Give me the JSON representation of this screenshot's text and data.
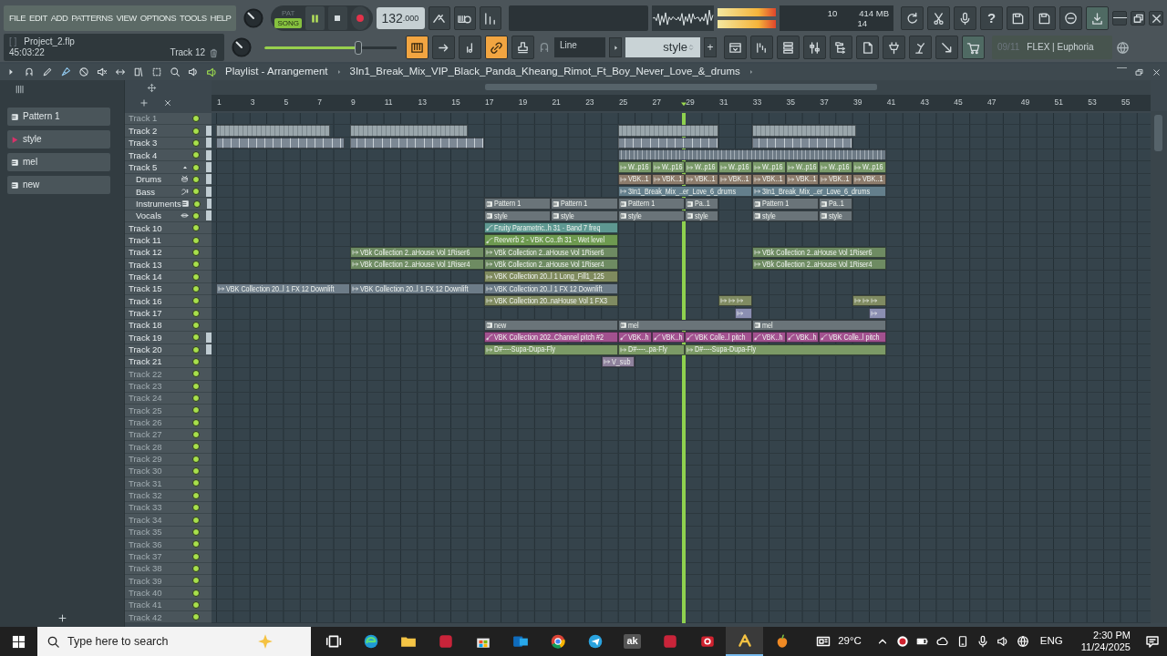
{
  "menu": [
    "FILE",
    "EDIT",
    "ADD",
    "PATTERNS",
    "VIEW",
    "OPTIONS",
    "TOOLS",
    "HELP"
  ],
  "transport": {
    "modes": [
      {
        "label": "PAT",
        "selected": false
      },
      {
        "label": "SONG",
        "selected": true
      }
    ],
    "playing": true
  },
  "tempo": "132",
  "tempo_fraction": ".000",
  "output_meter": [
    {
      "level": 1.0
    },
    {
      "level": 1.0
    }
  ],
  "cpu_panel": {
    "cpu": "10",
    "memory": "414 MB",
    "polyphony": "14"
  },
  "help_label": "?",
  "hint_panel": {
    "bracket": "[ ]",
    "project": "Project_2.flp",
    "time": "45:03:22",
    "track": "Track 12"
  },
  "master_volume": {
    "level": 0.71
  },
  "tool_buttons": [
    {
      "on": true
    },
    {
      "on": false
    },
    {
      "on": false
    },
    {
      "on": true
    },
    {
      "on": false
    }
  ],
  "snap": "Line",
  "pattern_selector": "style",
  "add_label": "+",
  "news": {
    "date": "09/11",
    "title": "FLEX | Euphoria"
  },
  "playlist": {
    "title": "Playlist - Arrangement",
    "arrangement": "3In1_Break_Mix_VIP_Black_Panda_Kheang_Rimot_Ft_Boy_Never_Love_&_drums"
  },
  "picker": [
    {
      "label": "Pattern 1",
      "selected": false
    },
    {
      "label": "style",
      "selected": true
    },
    {
      "label": "mel",
      "selected": false
    },
    {
      "label": "new",
      "selected": false
    }
  ],
  "ruler": [
    "1",
    "3",
    "5",
    "7",
    "9",
    "11",
    "13",
    "15",
    "17",
    "19",
    "21",
    "23",
    "25",
    "27",
    "29",
    "31",
    "33",
    "35",
    "37",
    "39",
    "41",
    "43",
    "45",
    "47",
    "49",
    "51",
    "53",
    "55"
  ],
  "tracks": [
    {
      "name": "Track 1",
      "dimmed": true,
      "on": true,
      "marked": false
    },
    {
      "name": "Track 2",
      "dimmed": false,
      "on": true,
      "marked": true,
      "clips": [
        {
          "kind": "blank",
          "color": "#9aa6ab"
        },
        {
          "kind": "blank",
          "color": "#9aa6ab"
        },
        {
          "kind": "blank",
          "color": "#9aa6ab"
        },
        {
          "kind": "blank",
          "color": "#9aa6ab"
        }
      ]
    },
    {
      "name": "Track 3",
      "dimmed": false,
      "on": true,
      "marked": true,
      "clips": [
        {
          "kind": "slices",
          "color": "#7c8894"
        },
        {
          "kind": "slices",
          "color": "#7c8894"
        },
        {
          "kind": "slices",
          "color": "#7c8894"
        },
        {
          "kind": "slices",
          "color": "#7c8894"
        }
      ]
    },
    {
      "name": "Track 4",
      "dimmed": false,
      "on": true,
      "marked": true,
      "clips": [
        {
          "kind": "stripe",
          "color": "#6d7a85"
        }
      ]
    },
    {
      "name": "Track 5",
      "dimmed": false,
      "on": true,
      "marked": true,
      "expanded": true,
      "clips": [
        {
          "kind": "audio",
          "label": "W..p16",
          "color": "#7a9a6a"
        },
        {
          "kind": "audio",
          "label": "W..p16",
          "color": "#7a9a6a"
        },
        {
          "kind": "audio",
          "label": "W..p16",
          "color": "#7a9a6a"
        },
        {
          "kind": "audio",
          "label": "W..p16",
          "color": "#7a9a6a"
        },
        {
          "kind": "audio",
          "label": "W..p16",
          "color": "#7a9a6a"
        },
        {
          "kind": "audio",
          "label": "W..p16",
          "color": "#7a9a6a"
        },
        {
          "kind": "audio",
          "label": "W..p16",
          "color": "#7a9a6a"
        },
        {
          "kind": "audio",
          "label": "W..p16",
          "color": "#7a9a6a"
        }
      ],
      "children": [
        {
          "name": "Drums",
          "dimmed": false,
          "on": true,
          "marked": true,
          "clips": [
            {
              "kind": "audio",
              "label": "VBK..1",
              "color": "#8d7c6c"
            },
            {
              "kind": "audio",
              "label": "VBK..1",
              "color": "#8d7c6c"
            },
            {
              "kind": "audio",
              "label": "VBK..1",
              "color": "#8d7c6c"
            },
            {
              "kind": "audio",
              "label": "VBK..1",
              "color": "#8d7c6c"
            },
            {
              "kind": "audio",
              "label": "VBK..1",
              "color": "#8d7c6c"
            },
            {
              "kind": "audio",
              "label": "VBK..1",
              "color": "#8d7c6c"
            },
            {
              "kind": "audio",
              "label": "VBK..1",
              "color": "#8d7c6c"
            },
            {
              "kind": "audio",
              "label": "VBK..1",
              "color": "#8d7c6c"
            }
          ]
        },
        {
          "name": "Bass",
          "dimmed": false,
          "on": true,
          "marked": true,
          "clips": [
            {
              "kind": "audio",
              "label": "3In1_Break_Mix_..er_Love_6_drums",
              "color": "#647f8c"
            },
            {
              "kind": "audio",
              "label": "3In1_Break_Mix_..er_Love_6_drums",
              "color": "#647f8c"
            }
          ]
        },
        {
          "name": "Instruments",
          "dimmed": false,
          "on": true,
          "marked": true,
          "clips": [
            {
              "kind": "pattern",
              "label": "Pattern 1",
              "color": "#6a7479"
            },
            {
              "kind": "pattern",
              "label": "Pattern 1",
              "color": "#6a7479"
            },
            {
              "kind": "pattern",
              "label": "Pattern 1",
              "color": "#6a7479"
            },
            {
              "kind": "pattern",
              "label": "Pa..1",
              "color": "#6a7479"
            },
            {
              "kind": "pattern",
              "label": "Pattern 1",
              "color": "#6a7479"
            },
            {
              "kind": "pattern",
              "label": "Pa..1",
              "color": "#6a7479"
            }
          ]
        },
        {
          "name": "Vocals",
          "dimmed": false,
          "on": true,
          "marked": true,
          "clips": [
            {
              "kind": "pattern",
              "label": "style",
              "color": "#6a7479"
            },
            {
              "kind": "pattern",
              "label": "style",
              "color": "#6a7479"
            },
            {
              "kind": "pattern",
              "label": "style",
              "color": "#6a7479"
            },
            {
              "kind": "pattern",
              "label": "style",
              "color": "#6a7479"
            },
            {
              "kind": "pattern",
              "label": "style",
              "color": "#6a7479"
            },
            {
              "kind": "pattern",
              "label": "style",
              "color": "#6a7479"
            }
          ]
        }
      ]
    },
    {
      "name": "Track 10",
      "dimmed": false,
      "on": true,
      "marked": false,
      "clips": [
        {
          "kind": "automation",
          "label": "Fruity Parametric..h 31 - Band 7 freq",
          "color": "#5e9891"
        }
      ]
    },
    {
      "name": "Track 11",
      "dimmed": false,
      "on": true,
      "marked": false,
      "clips": [
        {
          "kind": "automation",
          "label": "Reeverb 2 - VBK Co..th 31 - Wet level",
          "color": "#6e9a50"
        }
      ]
    },
    {
      "name": "Track 12",
      "dimmed": false,
      "on": true,
      "marked": false,
      "clips": [
        {
          "kind": "audio",
          "label": "VBk Collection 2..aHouse Vol 1Riser6",
          "color": "#6e8b62"
        },
        {
          "kind": "audio",
          "label": "VBk Collection 2..aHouse Vol 1Riser6",
          "color": "#6e8b62"
        },
        {
          "kind": "audio",
          "label": "VBk Collection 2..aHouse Vol 1Riser6",
          "color": "#6e8b62"
        }
      ]
    },
    {
      "name": "Track 13",
      "dimmed": false,
      "on": true,
      "marked": false,
      "clips": [
        {
          "kind": "audio",
          "label": "VBk Collection 2..aHouse Vol 1Riser4",
          "color": "#6e8b62"
        },
        {
          "kind": "audio",
          "label": "VBk Collection 2..aHouse Vol 1Riser4",
          "color": "#6e8b62"
        },
        {
          "kind": "audio",
          "label": "VBk Collection 2..aHouse Vol 1Riser4",
          "color": "#6e8b62"
        }
      ]
    },
    {
      "name": "Track 14",
      "dimmed": false,
      "on": true,
      "marked": false,
      "clips": [
        {
          "kind": "audio",
          "label": "VBK Collection 20..l 1 Long_Fill1_125",
          "color": "#7f8a5e"
        }
      ]
    },
    {
      "name": "Track 15",
      "dimmed": false,
      "on": true,
      "marked": false,
      "clips": [
        {
          "kind": "audio",
          "label": "VBK Collection 20..l 1 FX 12 Downlift",
          "color": "#6d7c88"
        },
        {
          "kind": "audio",
          "label": "VBK Collection 20..l 1 FX 12 Downlift",
          "color": "#6d7c88"
        },
        {
          "kind": "audio",
          "label": "VBK Collection 20..l 1 FX 12 Downlift",
          "color": "#6d7c88"
        }
      ]
    },
    {
      "name": "Track 16",
      "dimmed": false,
      "on": true,
      "marked": false,
      "clips": [
        {
          "kind": "audio",
          "label": "VBK Collection 20..naHouse Vol 1 FX3",
          "color": "#808b62"
        },
        {
          "kind": "chops",
          "color": "#808b62"
        },
        {
          "kind": "chops",
          "color": "#808b62"
        }
      ]
    },
    {
      "name": "Track 17",
      "dimmed": false,
      "on": true,
      "marked": false,
      "clips": [
        {
          "kind": "audio",
          "color": "#8b8fb2"
        },
        {
          "kind": "audio",
          "color": "#8b8fb2"
        }
      ]
    },
    {
      "name": "Track 18",
      "dimmed": false,
      "on": true,
      "marked": false,
      "clips": [
        {
          "kind": "pattern",
          "label": "new",
          "color": "#6a7479"
        },
        {
          "kind": "pattern",
          "label": "mel",
          "color": "#6a7479"
        },
        {
          "kind": "pattern",
          "label": "mel",
          "color": "#6a7479"
        }
      ]
    },
    {
      "name": "Track 19",
      "dimmed": false,
      "on": true,
      "marked": true,
      "clips": [
        {
          "kind": "automation",
          "label": "VBK Collection 202..Channel pitch #2",
          "color": "#a2518f"
        },
        {
          "kind": "automation",
          "label": "VBK..h",
          "color": "#a2518f"
        },
        {
          "kind": "automation",
          "label": "VBK..h",
          "color": "#a2518f"
        },
        {
          "kind": "automation",
          "label": "VBK Colle..l pitch",
          "color": "#a2518f"
        },
        {
          "kind": "automation",
          "label": "VBK..h",
          "color": "#a2518f"
        },
        {
          "kind": "automation",
          "label": "VBK..h",
          "color": "#a2518f"
        },
        {
          "kind": "automation",
          "label": "VBK Colle..l pitch",
          "color": "#a2518f"
        }
      ]
    },
    {
      "name": "Track 20",
      "dimmed": false,
      "on": true,
      "marked": true,
      "clips": [
        {
          "kind": "audio",
          "label": "D#----Supa-Dupa-Fly",
          "color": "#7c9a66"
        },
        {
          "kind": "audio",
          "label": "D#----..pa-Fly",
          "color": "#7c9a66"
        },
        {
          "kind": "audio",
          "label": "D#----Supa-Dupa-Fly",
          "color": "#7c9a66"
        }
      ]
    },
    {
      "name": "Track 21",
      "dimmed": false,
      "on": true,
      "marked": false,
      "clips": [
        {
          "kind": "audio",
          "label": "V_sub",
          "color": "#8e819c"
        }
      ]
    },
    {
      "name": "Track 22",
      "dimmed": true,
      "on": true,
      "marked": false
    },
    {
      "name": "Track 23",
      "dimmed": true,
      "on": true,
      "marked": false
    },
    {
      "name": "Track 24",
      "dimmed": true,
      "on": true,
      "marked": false
    },
    {
      "name": "Track 25",
      "dimmed": true,
      "on": true,
      "marked": false
    },
    {
      "name": "Track 26",
      "dimmed": true,
      "on": true,
      "marked": false
    },
    {
      "name": "Track 27",
      "dimmed": true,
      "on": true,
      "marked": false
    },
    {
      "name": "Track 28",
      "dimmed": true,
      "on": true,
      "marked": false
    },
    {
      "name": "Track 29",
      "dimmed": true,
      "on": true,
      "marked": false
    },
    {
      "name": "Track 30",
      "dimmed": true,
      "on": true,
      "marked": false
    },
    {
      "name": "Track 31",
      "dimmed": true,
      "on": true,
      "marked": false
    },
    {
      "name": "Track 32",
      "dimmed": true,
      "on": true,
      "marked": false
    },
    {
      "name": "Track 33",
      "dimmed": true,
      "on": true,
      "marked": false
    },
    {
      "name": "Track 34",
      "dimmed": true,
      "on": true,
      "marked": false
    },
    {
      "name": "Track 35",
      "dimmed": true,
      "on": true,
      "marked": false
    },
    {
      "name": "Track 36",
      "dimmed": true,
      "on": true,
      "marked": false
    },
    {
      "name": "Track 37",
      "dimmed": true,
      "on": true,
      "marked": false
    },
    {
      "name": "Track 38",
      "dimmed": true,
      "on": true,
      "marked": false
    },
    {
      "name": "Track 39",
      "dimmed": true,
      "on": true,
      "marked": false
    },
    {
      "name": "Track 40",
      "dimmed": true,
      "on": true,
      "marked": false
    },
    {
      "name": "Track 41",
      "dimmed": true,
      "on": true,
      "marked": false
    },
    {
      "name": "Track 42",
      "dimmed": true,
      "on": true,
      "marked": false
    }
  ],
  "taskbar": {
    "search_placeholder": "Type here to search",
    "apps": [
      {
        "active": false
      },
      {
        "active": false
      },
      {
        "active": false
      },
      {
        "active": false
      },
      {
        "active": false
      },
      {
        "active": false
      },
      {
        "active": false
      },
      {
        "active": false
      },
      {
        "active": false,
        "label": "ak"
      },
      {
        "active": false
      },
      {
        "active": false
      },
      {
        "active": true
      },
      {
        "active": false
      }
    ],
    "weather": "29°C",
    "language": "ENG",
    "time": "2:30 PM",
    "date": "11/24/2025"
  }
}
